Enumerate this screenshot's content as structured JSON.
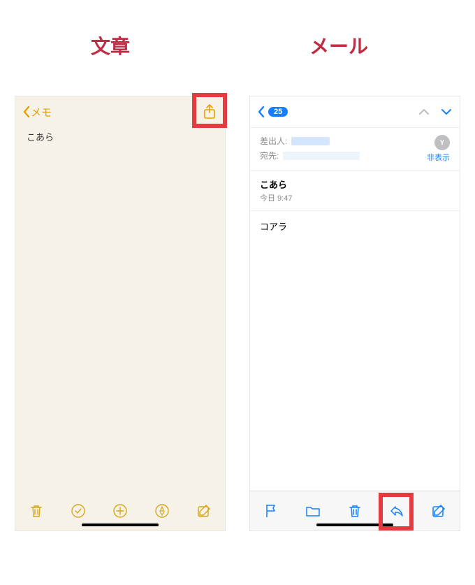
{
  "headings": {
    "left": "文章",
    "right": "メール"
  },
  "notes": {
    "back_label": "メモ",
    "content": "こあら",
    "icons": [
      "trash",
      "check-circle",
      "plus-circle",
      "pen-tip",
      "compose"
    ]
  },
  "mail": {
    "badge_count": "25",
    "sender_label": "差出人:",
    "recipient_label": "宛先:",
    "hide_link": "非表示",
    "avatar_initial": "Y",
    "subject": "こあら",
    "date_line": "今日 9:47",
    "body": "コアラ",
    "toolbar_icons": [
      "flag",
      "folder",
      "trash",
      "reply",
      "compose"
    ]
  }
}
